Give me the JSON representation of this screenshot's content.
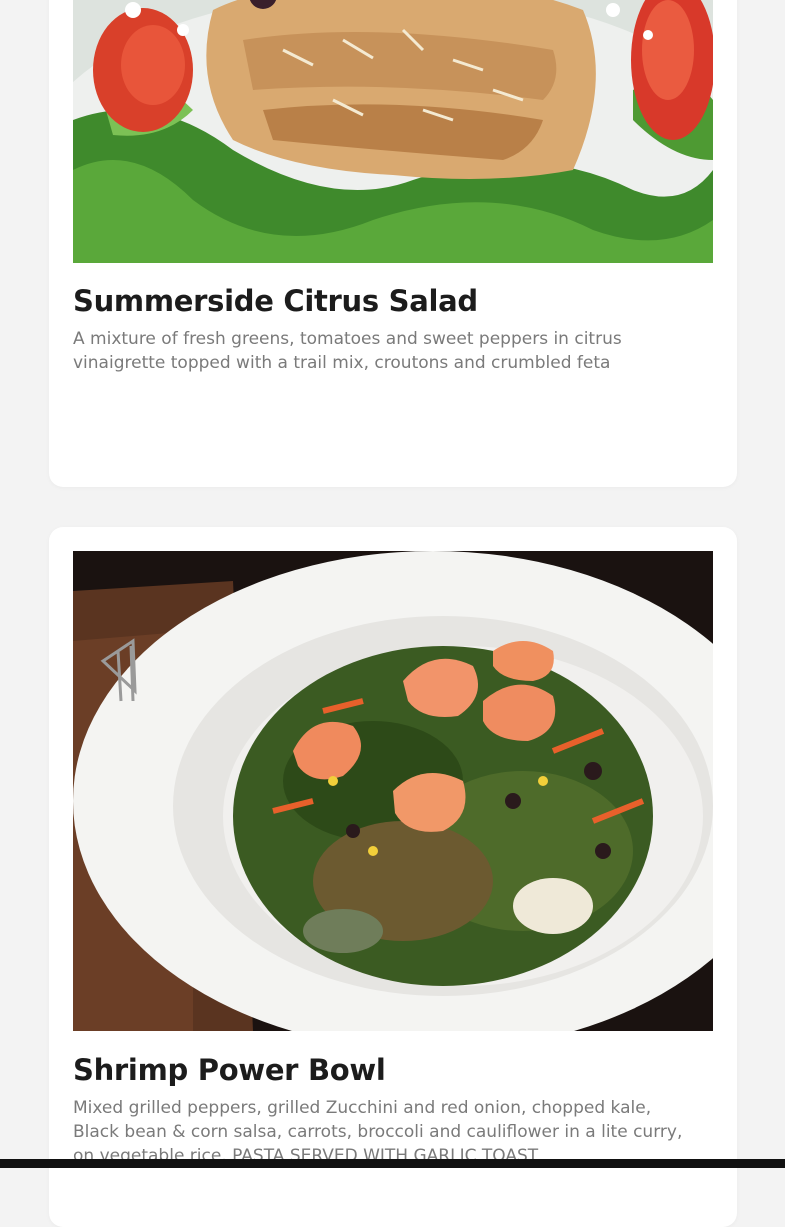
{
  "menu_items": [
    {
      "title": "Summerside Citrus Salad",
      "description": "A mixture of fresh greens, tomatoes and sweet peppers in citrus vinaigrette topped with a trail mix, croutons and crumbled feta",
      "image_icon": "salad-photo"
    },
    {
      "title": "Shrimp Power Bowl",
      "description": "Mixed grilled peppers, grilled Zucchini and red onion, chopped kale, Black bean & corn salsa, carrots, broccoli and cauliflower in a lite curry, on vegetable rice. PASTA SERVED WITH GARLIC TOAST",
      "image_icon": "shrimp-bowl-photo"
    }
  ],
  "colors": {
    "page_background": "#f3f3f3",
    "card_background": "#ffffff",
    "title": "#1c1c1c",
    "description": "#7a7a7a"
  }
}
